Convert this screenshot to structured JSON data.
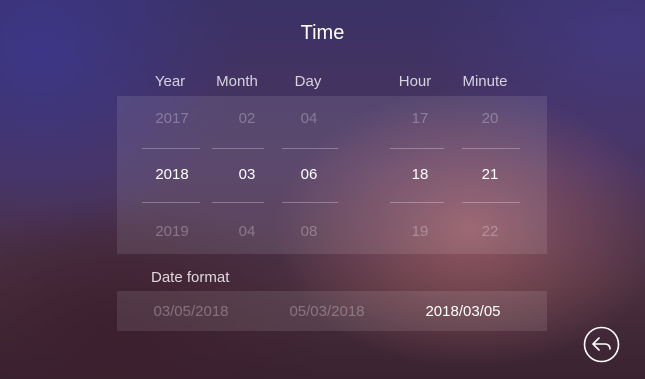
{
  "title": "Time",
  "columns": {
    "year": {
      "label": "Year",
      "above": "2017",
      "selected": "2018",
      "below": "2019"
    },
    "month": {
      "label": "Month",
      "above": "02",
      "selected": "03",
      "below": "04"
    },
    "day": {
      "label": "Day",
      "above": "04",
      "selected": "06",
      "below": "08"
    },
    "hour": {
      "label": "Hour",
      "above": "17",
      "selected": "18",
      "below": "19"
    },
    "minute": {
      "label": "Minute",
      "above": "20",
      "selected": "21",
      "below": "22"
    }
  },
  "date_format": {
    "label": "Date format",
    "options": [
      "03/05/2018",
      "05/03/2018",
      "2018/03/05"
    ],
    "selected": "2018/03/05"
  },
  "back_button": {
    "icon": "back-arrow-icon"
  },
  "colors": {
    "text_selected": "#ffffff",
    "text_dim": "rgba(255,255,255,0.28)",
    "panel": "rgba(255,255,255,0.10)"
  }
}
